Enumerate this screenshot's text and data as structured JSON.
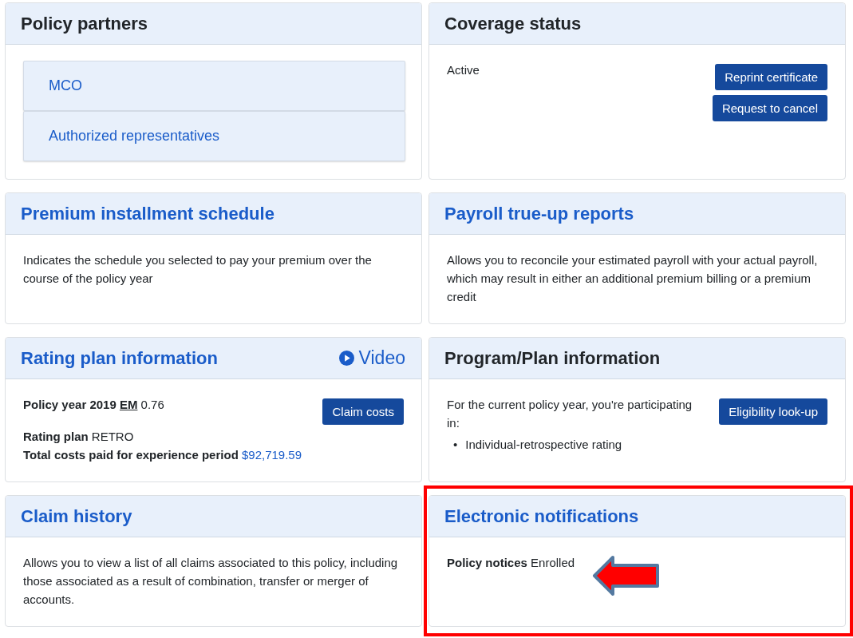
{
  "cards": [
    {
      "title": "Policy partners",
      "title_link": false,
      "highlighted": false,
      "links": [
        "MCO",
        "Authorized representatives"
      ]
    },
    {
      "title": "Coverage status",
      "title_link": false,
      "highlighted": false,
      "text": "Active",
      "buttons": [
        "Reprint certificate",
        "Request to cancel"
      ]
    },
    {
      "title": "Premium installment schedule",
      "title_link": true,
      "highlighted": false,
      "text": "Indicates the schedule you selected to pay your premium over the course of the policy year"
    },
    {
      "title": "Payroll true-up reports",
      "title_link": true,
      "highlighted": false,
      "text": "Allows you to reconcile your estimated payroll with your actual payroll, which may result in either an additional premium billing or a premium credit"
    },
    {
      "title": "Rating plan information",
      "title_link": true,
      "highlighted": false,
      "action": "Video",
      "field_groups": [
        [
          {
            "label": "Policy year 2019",
            "abbr": "EM",
            "value": "0.76",
            "value_link": false
          }
        ],
        [
          {
            "label": "Rating plan",
            "value": "RETRO",
            "value_link": false
          },
          {
            "label": "Total costs paid for experience period",
            "value": "$92,719.59",
            "value_link": true
          }
        ]
      ],
      "buttons": [
        "Claim costs"
      ]
    },
    {
      "title": "Program/Plan information",
      "title_link": false,
      "highlighted": false,
      "text": "For the current policy year, you're participating in:",
      "bullets": [
        {
          "marker": "•",
          "text": "Individual-retrospective rating"
        }
      ],
      "buttons": [
        "Eligibility look-up"
      ]
    },
    {
      "title": "Claim history",
      "title_link": true,
      "highlighted": false,
      "text": "Allows you to view a list of all claims associated to this policy, including those associated as a result of combination, transfer or merger of accounts."
    },
    {
      "title": "Electronic notifications",
      "title_link": true,
      "highlighted": true,
      "pointer_arrow": true,
      "field_groups": [
        [
          {
            "label": "Policy notices",
            "value": "Enrolled",
            "value_link": false
          }
        ]
      ]
    }
  ]
}
